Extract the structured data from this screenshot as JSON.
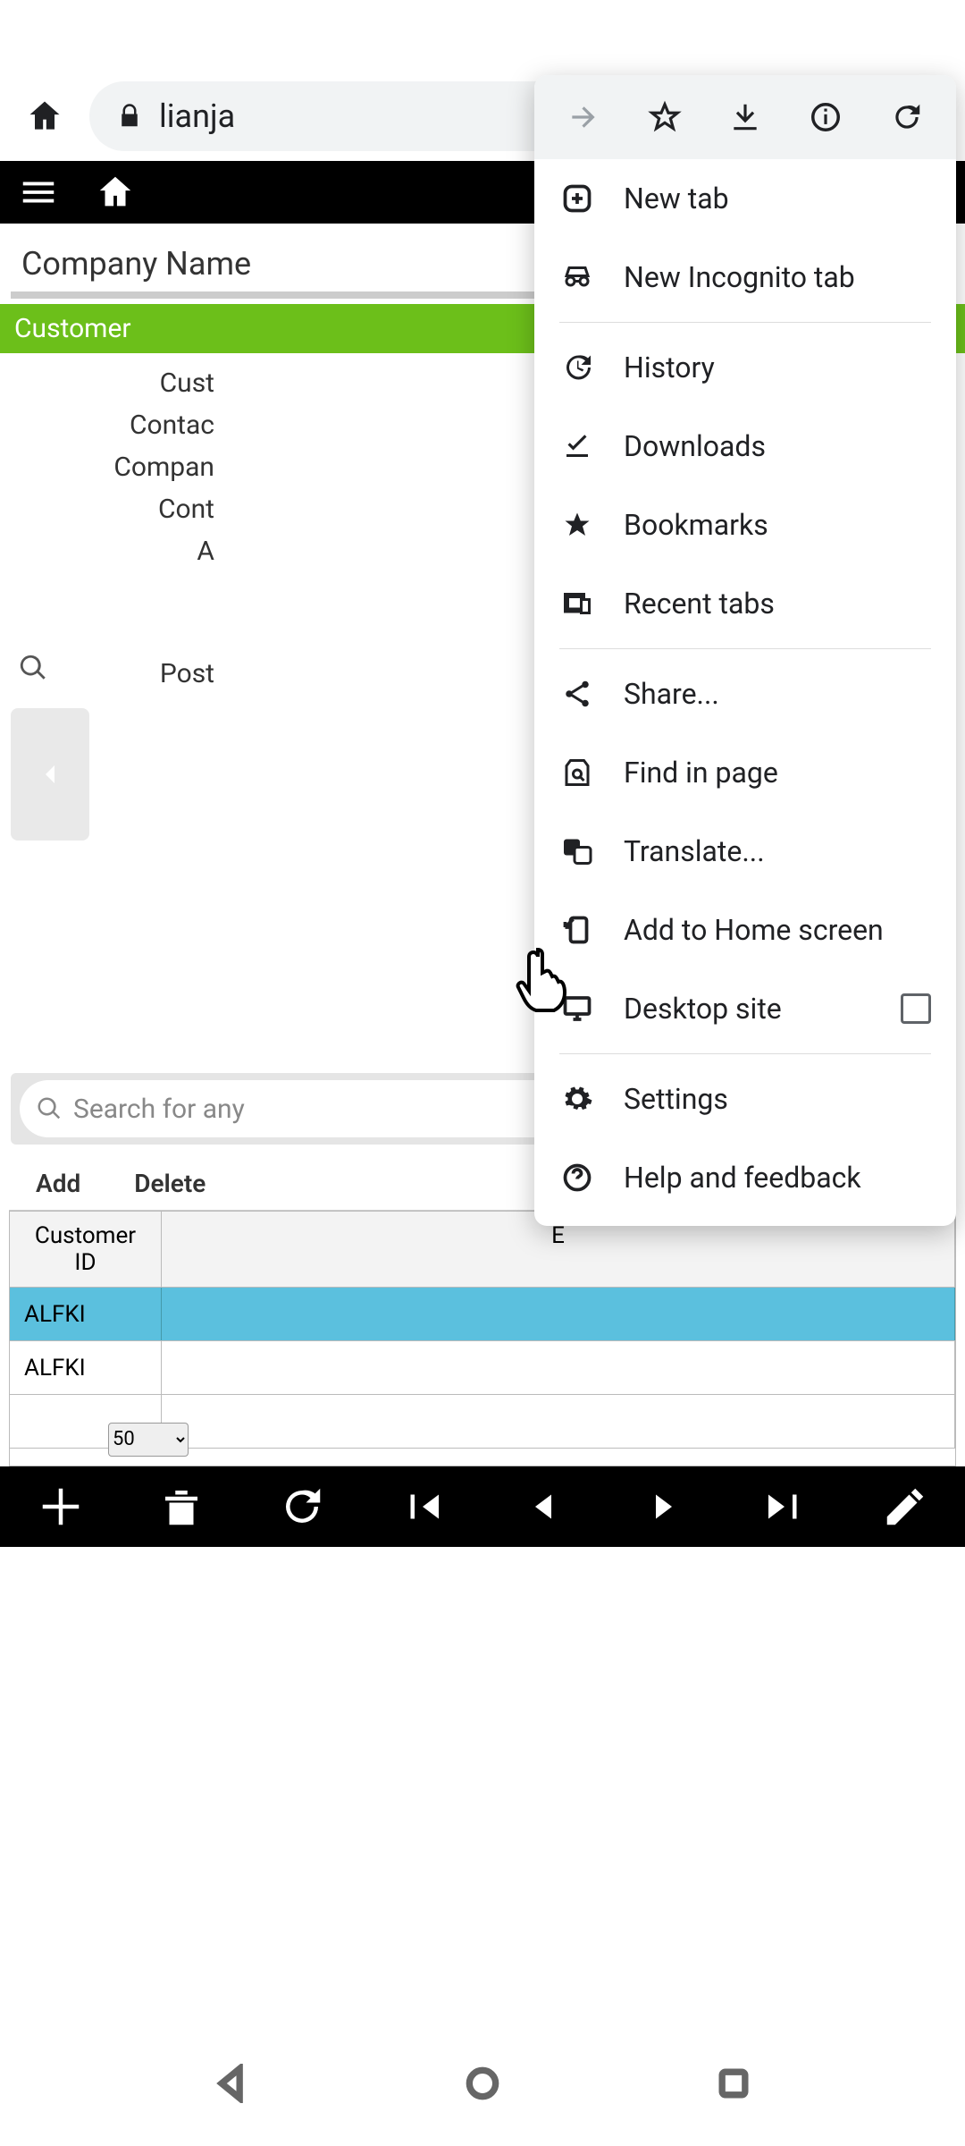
{
  "browser": {
    "url_display": "lianja",
    "menu_icon_row": [
      "forward",
      "star",
      "download",
      "info",
      "reload"
    ]
  },
  "menu": {
    "items_top": [
      {
        "icon": "plus-box",
        "label": "New tab"
      },
      {
        "icon": "incognito",
        "label": "New Incognito tab"
      }
    ],
    "items_mid": [
      {
        "icon": "history",
        "label": "History"
      },
      {
        "icon": "check-download",
        "label": "Downloads"
      },
      {
        "icon": "star-filled",
        "label": "Bookmarks"
      },
      {
        "icon": "devices",
        "label": "Recent tabs"
      }
    ],
    "items_mid2": [
      {
        "icon": "share",
        "label": "Share..."
      },
      {
        "icon": "find",
        "label": "Find in page"
      },
      {
        "icon": "translate",
        "label": "Translate..."
      },
      {
        "icon": "add-home",
        "label": "Add to Home screen"
      },
      {
        "icon": "desktop",
        "label": "Desktop site",
        "checkbox": true
      }
    ],
    "items_bottom": [
      {
        "icon": "gear",
        "label": "Settings"
      },
      {
        "icon": "help",
        "label": "Help and feedback"
      }
    ]
  },
  "app": {
    "section_title": "Company Name",
    "green_bar": "Customer",
    "field_labels": [
      "Cust",
      "Contac",
      "Compan",
      "Cont",
      "A",
      "Post"
    ],
    "search_placeholder": "Search for any",
    "actions": {
      "add": "Add",
      "delete": "Delete"
    },
    "table": {
      "headers": [
        "Customer ID",
        "E"
      ],
      "rows": [
        {
          "id": "ALFKI",
          "selected": true
        },
        {
          "id": "ALFKI",
          "selected": false
        }
      ]
    },
    "pager_value": "50"
  }
}
